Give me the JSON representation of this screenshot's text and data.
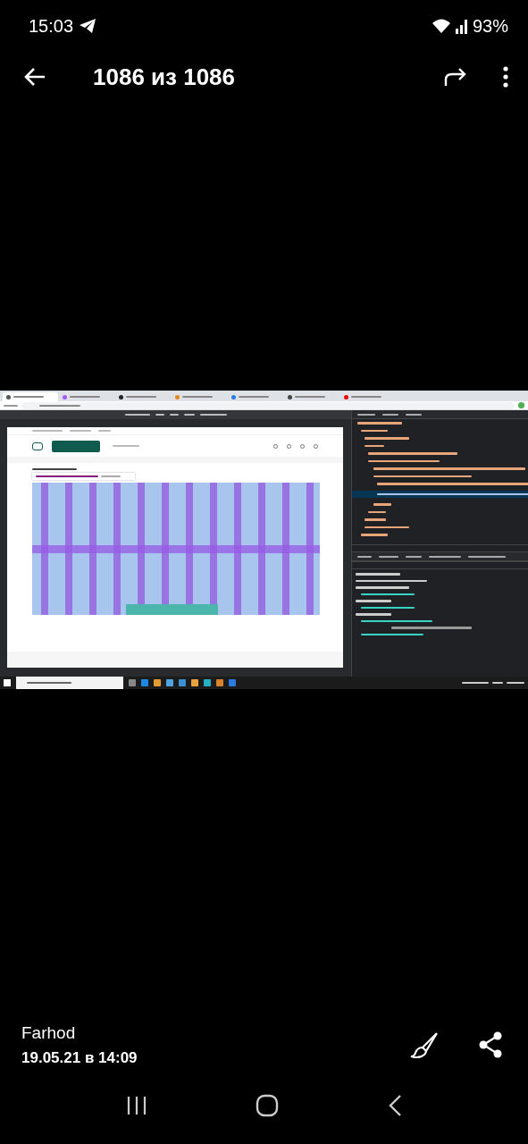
{
  "status_bar": {
    "time": "15:03",
    "battery": "93%"
  },
  "header": {
    "counter": "1086 из 1086"
  },
  "footer": {
    "author": "Farhod",
    "date": "19.05.21 в 14:09"
  }
}
